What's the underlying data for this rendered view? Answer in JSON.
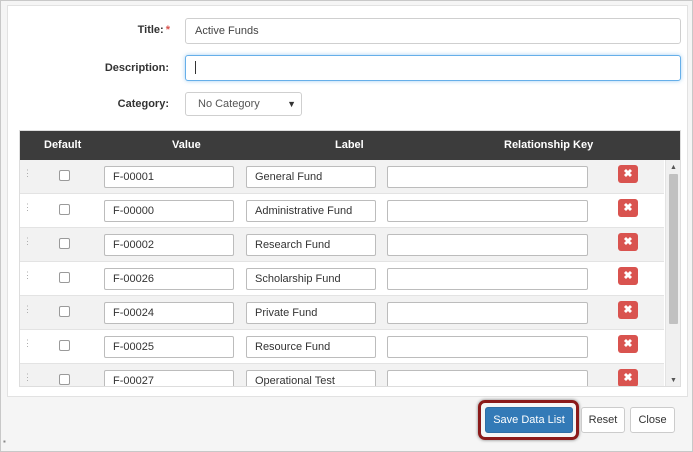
{
  "form": {
    "title_label": "Title:",
    "title_required": "*",
    "title_value": "Active Funds",
    "description_label": "Description:",
    "description_value": "",
    "category_label": "Category:",
    "category_value": "No Category"
  },
  "grid": {
    "headers": {
      "default": "Default",
      "value": "Value",
      "label": "Label",
      "relationship_key": "Relationship Key"
    },
    "rows": [
      {
        "value": "F-00001",
        "label": "General Fund",
        "key": ""
      },
      {
        "value": "F-00000",
        "label": "Administrative Fund",
        "key": ""
      },
      {
        "value": "F-00002",
        "label": "Research Fund",
        "key": ""
      },
      {
        "value": "F-00026",
        "label": "Scholarship Fund",
        "key": ""
      },
      {
        "value": "F-00024",
        "label": "Private Fund",
        "key": ""
      },
      {
        "value": "F-00025",
        "label": "Resource Fund",
        "key": ""
      },
      {
        "value": "F-00027",
        "label": "Operational Test",
        "key": ""
      }
    ],
    "delete_glyph": "✖"
  },
  "footer": {
    "save_label": "Save Data List",
    "reset_label": "Reset",
    "close_label": "Close"
  },
  "colors": {
    "header_bg": "#3c3c3c",
    "primary": "#337ab7",
    "danger": "#d9534f",
    "highlight": "#8b1a1a"
  }
}
